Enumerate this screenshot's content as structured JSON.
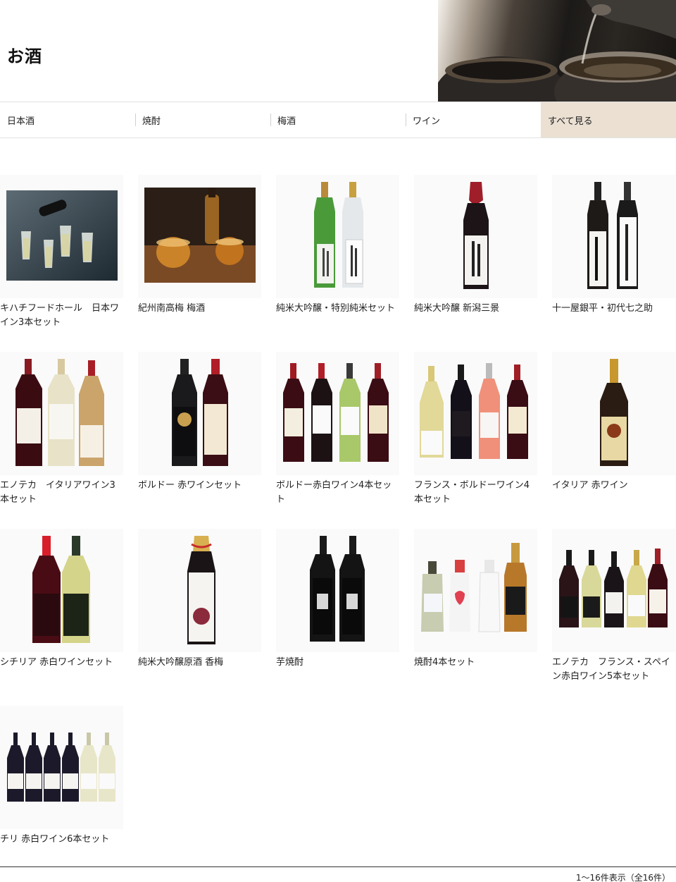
{
  "page": {
    "title": "お酒"
  },
  "categories": [
    {
      "label": "日本酒",
      "active": false
    },
    {
      "label": "焼酎",
      "active": false
    },
    {
      "label": "梅酒",
      "active": false
    },
    {
      "label": "ワイン",
      "active": false
    },
    {
      "label": "すべて見る",
      "active": true
    }
  ],
  "products": [
    {
      "name": "キハチフードホール　日本ワイン3本セット",
      "image": "sparkling-wine-glasses-photo"
    },
    {
      "name": "紀州南高梅 梅酒",
      "image": "umeshu-glass-photo"
    },
    {
      "name": "純米大吟醸・特別純米セット",
      "image": "sake-bottles-2"
    },
    {
      "name": "純米大吟醸 新潟三景",
      "image": "sake-bottle-red-cap"
    },
    {
      "name": "十一屋銀平・初代七之助",
      "image": "sake-bottles-2-black"
    },
    {
      "name": "エノテカ　イタリアワイン3本セット",
      "image": "wine-bottles-3"
    },
    {
      "name": "ボルドー 赤ワインセット",
      "image": "wine-bottles-2"
    },
    {
      "name": "ボルドー赤白ワイン4本セット",
      "image": "wine-bottles-4"
    },
    {
      "name": "フランス・ボルドーワイン4本セット",
      "image": "wine-bottles-4-rose"
    },
    {
      "name": "イタリア 赤ワイン",
      "image": "wine-bottle-1"
    },
    {
      "name": "シチリア 赤白ワインセット",
      "image": "wine-bottles-2-red-white"
    },
    {
      "name": "純米大吟醸原酒 香梅",
      "image": "sake-bottle-gift"
    },
    {
      "name": "芋焼酎",
      "image": "shochu-bottles-2"
    },
    {
      "name": "焼酎4本セット",
      "image": "shochu-bottles-4"
    },
    {
      "name": "エノテカ　フランス・スペイン赤白ワイン5本セット",
      "image": "wine-bottles-5"
    },
    {
      "name": "チリ 赤白ワイン6本セット",
      "image": "wine-bottles-6"
    }
  ],
  "pagination": {
    "summary": "1～16件表示（全16件）"
  },
  "colors": {
    "active_tab_bg": "#ebe0d2",
    "text": "#222222"
  }
}
